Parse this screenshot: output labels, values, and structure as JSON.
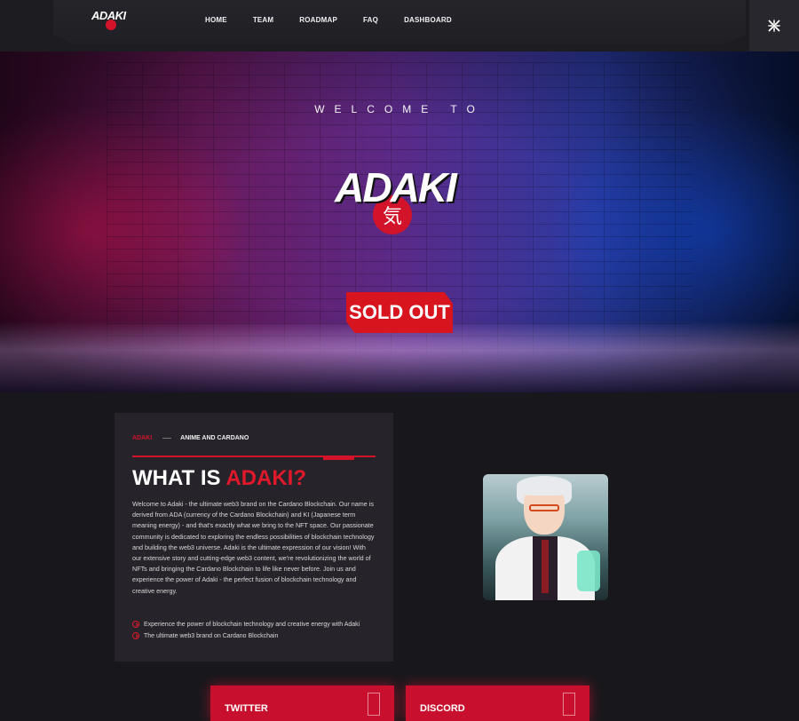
{
  "header": {
    "logo_text": "ADAKI",
    "nav": [
      "HOME",
      "TEAM",
      "ROADMAP",
      "FAQ",
      "DASHBOARD"
    ]
  },
  "hero": {
    "welcome": "WELCOME TO",
    "logo_text": "ADAKI",
    "logo_kanji": "気",
    "badge": "SOLD OUT"
  },
  "about": {
    "crumb_primary": "ADAKI",
    "crumb_secondary": "ANIME AND CARDANO",
    "title_prefix": "WHAT IS ",
    "title_highlight": "ADAKI?",
    "body": "Welcome to Adaki - the ultimate web3 brand on the Cardano Blockchain. Our name is derived from ADA (currency of the Cardano Blockchain) and KI (Japanese term meaning energy) - and that's exactly what we bring to the NFT space. Our passionate community is dedicated to exploring the endless possibilities of blockchain technology and building the web3 universe. Adaki is the ultimate expression of our vision! With our extensive story and cutting-edge web3 content, we're revolutionizing the world of NFTs and bringing the Cardano Blockchain to life like never before. Join us and experience the power of Adaki - the perfect fusion of blockchain technology and creative energy.",
    "bullets": [
      "Experience the power of blockchain technology and creative energy with Adaki",
      "The ultimate web3 brand on Cardano Blockchain"
    ]
  },
  "social": [
    {
      "label": "TWITTER"
    },
    {
      "label": "DISCORD"
    }
  ],
  "colors": {
    "accent": "#d3132a",
    "background": "#18181c",
    "card": "#26242a"
  },
  "icons": {
    "corner": "x-shuriken-icon",
    "bullet": "circle-chevron-icon"
  }
}
